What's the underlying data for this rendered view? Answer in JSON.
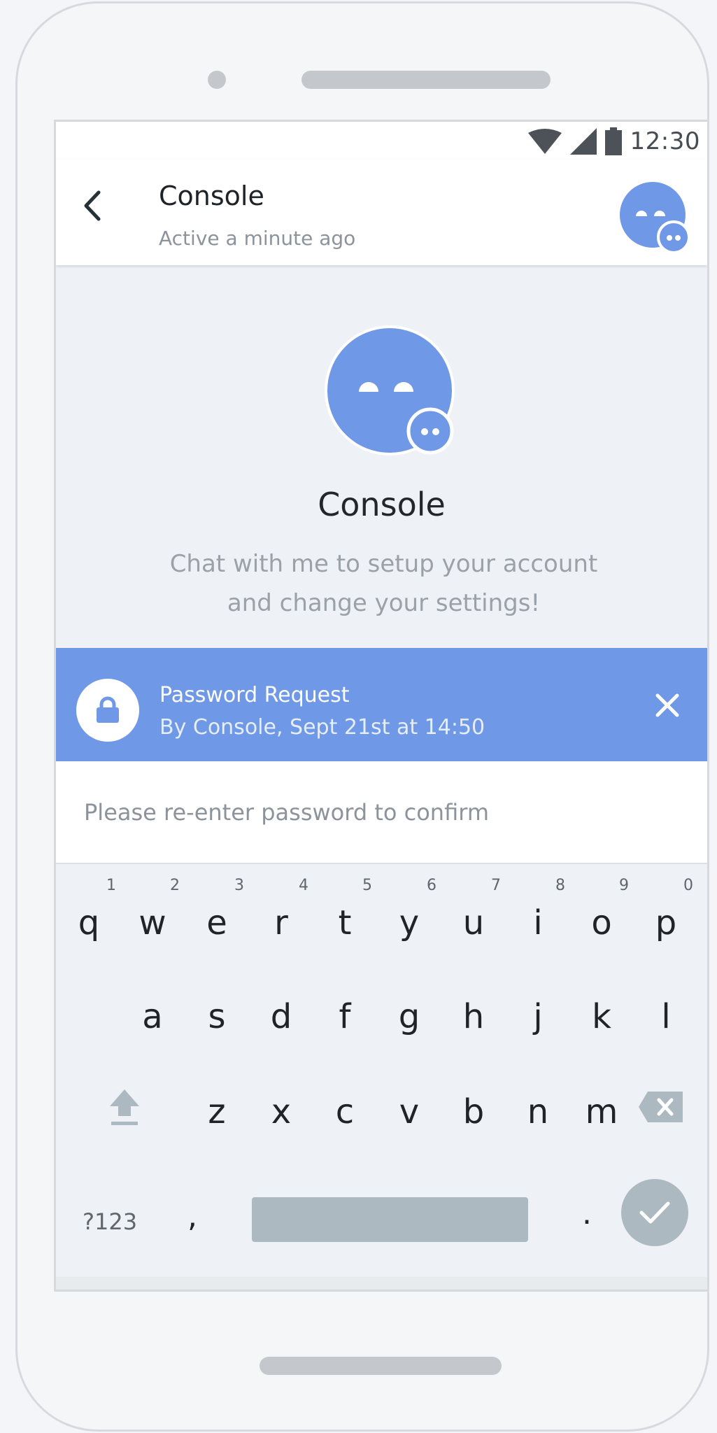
{
  "status_bar": {
    "time": "12:30",
    "icons": [
      "wifi-icon",
      "signal-icon",
      "battery-icon"
    ]
  },
  "header": {
    "title": "Console",
    "subtitle": "Active a minute ago"
  },
  "profile": {
    "name": "Console",
    "description_line1": "Chat with me to setup your account",
    "description_line2": "and change your settings!"
  },
  "password_request": {
    "title": "Password Request",
    "subtitle": "By Console, Sept 21st at 14:50"
  },
  "password_input": {
    "placeholder": "Please re-enter password to confirm",
    "value": ""
  },
  "keyboard": {
    "row1": [
      {
        "char": "q",
        "num": "1"
      },
      {
        "char": "w",
        "num": "2"
      },
      {
        "char": "e",
        "num": "3"
      },
      {
        "char": "r",
        "num": "4"
      },
      {
        "char": "t",
        "num": "5"
      },
      {
        "char": "y",
        "num": "6"
      },
      {
        "char": "u",
        "num": "7"
      },
      {
        "char": "i",
        "num": "8"
      },
      {
        "char": "o",
        "num": "9"
      },
      {
        "char": "p",
        "num": "0"
      }
    ],
    "row2": [
      "a",
      "s",
      "d",
      "f",
      "g",
      "h",
      "j",
      "k",
      "l"
    ],
    "row3": [
      "z",
      "x",
      "c",
      "v",
      "b",
      "n",
      "m"
    ],
    "symbols_label": "?123",
    "comma_label": ",",
    "period_label": "."
  },
  "colors": {
    "accent": "#6f98e6",
    "key_gray": "#adb9c1",
    "background": "#eef1f5"
  }
}
